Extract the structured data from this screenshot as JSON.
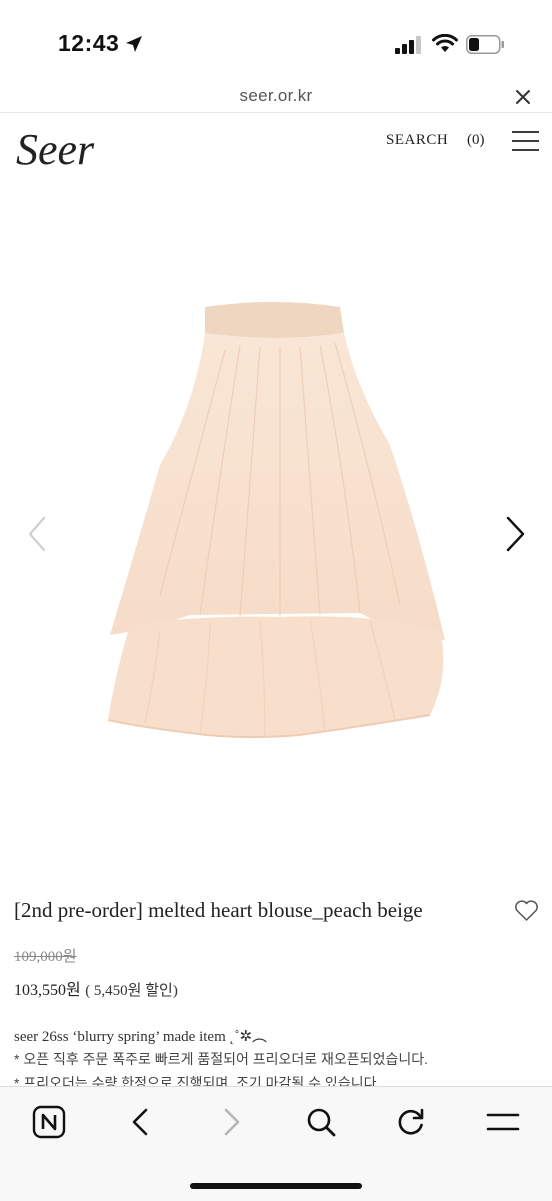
{
  "status_bar": {
    "time": "12:43"
  },
  "browser": {
    "url": "seer.or.kr"
  },
  "header": {
    "logo": "Seer",
    "search_label": "SEARCH",
    "cart_count": "(0)"
  },
  "product": {
    "title": "[2nd pre-order] melted heart blouse_peach beige",
    "original_price": "109,000원",
    "sale_price": "103,550원",
    "discount": "( 5,450원 할인)",
    "description_lines": [
      "seer 26ss ‘blurry spring’ made item ˛˚✲︵",
      "* 오픈 직후 주문 폭주로 빠르게 품절되어 프리오더로 재오픈되었습니다.",
      "* 프리오더는 수량 한정으로 진행되며, 조기 마감될 수 있습니다."
    ],
    "image_description": "peach-beige-sleeveless-blouse"
  },
  "colors": {
    "garment": "#f8e0cc",
    "text": "#222222",
    "muted": "#888888"
  },
  "icons": {
    "toolbar": [
      "naver-home-icon",
      "back-icon",
      "forward-icon",
      "search-icon",
      "reload-icon",
      "menu-icon"
    ]
  }
}
